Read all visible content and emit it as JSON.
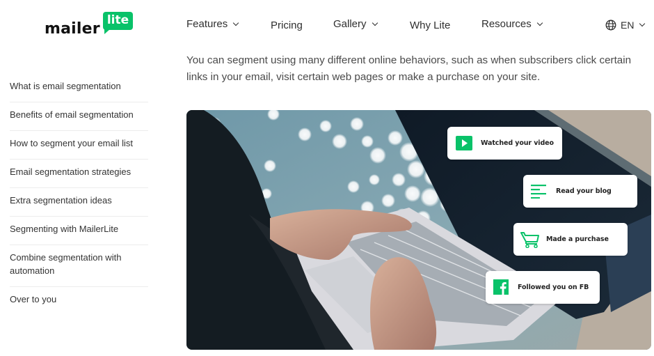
{
  "brand": {
    "wordmark": "mailer",
    "badge": "lite",
    "accent_color": "#09c269"
  },
  "nav": {
    "items": [
      {
        "label": "Features",
        "has_dropdown": true
      },
      {
        "label": "Pricing",
        "has_dropdown": false
      },
      {
        "label": "Gallery",
        "has_dropdown": true
      },
      {
        "label": "Why Lite",
        "has_dropdown": false
      },
      {
        "label": "Resources",
        "has_dropdown": true
      }
    ],
    "language": {
      "icon": "globe-icon",
      "label": "EN",
      "has_dropdown": true
    }
  },
  "toc": {
    "items": [
      "What is email segmentation",
      "Benefits of email segmentation",
      "How to segment your email list",
      "Email segmentation strategies",
      "Extra segmentation ideas",
      "Segmenting with MailerLite",
      "Combine segmentation with automation",
      "Over to you"
    ]
  },
  "content": {
    "intro": "You can segment using many different online behaviors, such as when subscribers click certain links in your email, visit certain web pages or make a purchase on your site."
  },
  "hero": {
    "description": "Person typing on a laptop by the water with behavior cards overlay",
    "cards": [
      {
        "icon": "play-video-icon",
        "label": "Watched your video"
      },
      {
        "icon": "blog-lines-icon",
        "label": "Read your blog"
      },
      {
        "icon": "shopping-cart-icon",
        "label": "Made a purchase"
      },
      {
        "icon": "facebook-icon",
        "label": "Followed you on FB"
      }
    ]
  }
}
